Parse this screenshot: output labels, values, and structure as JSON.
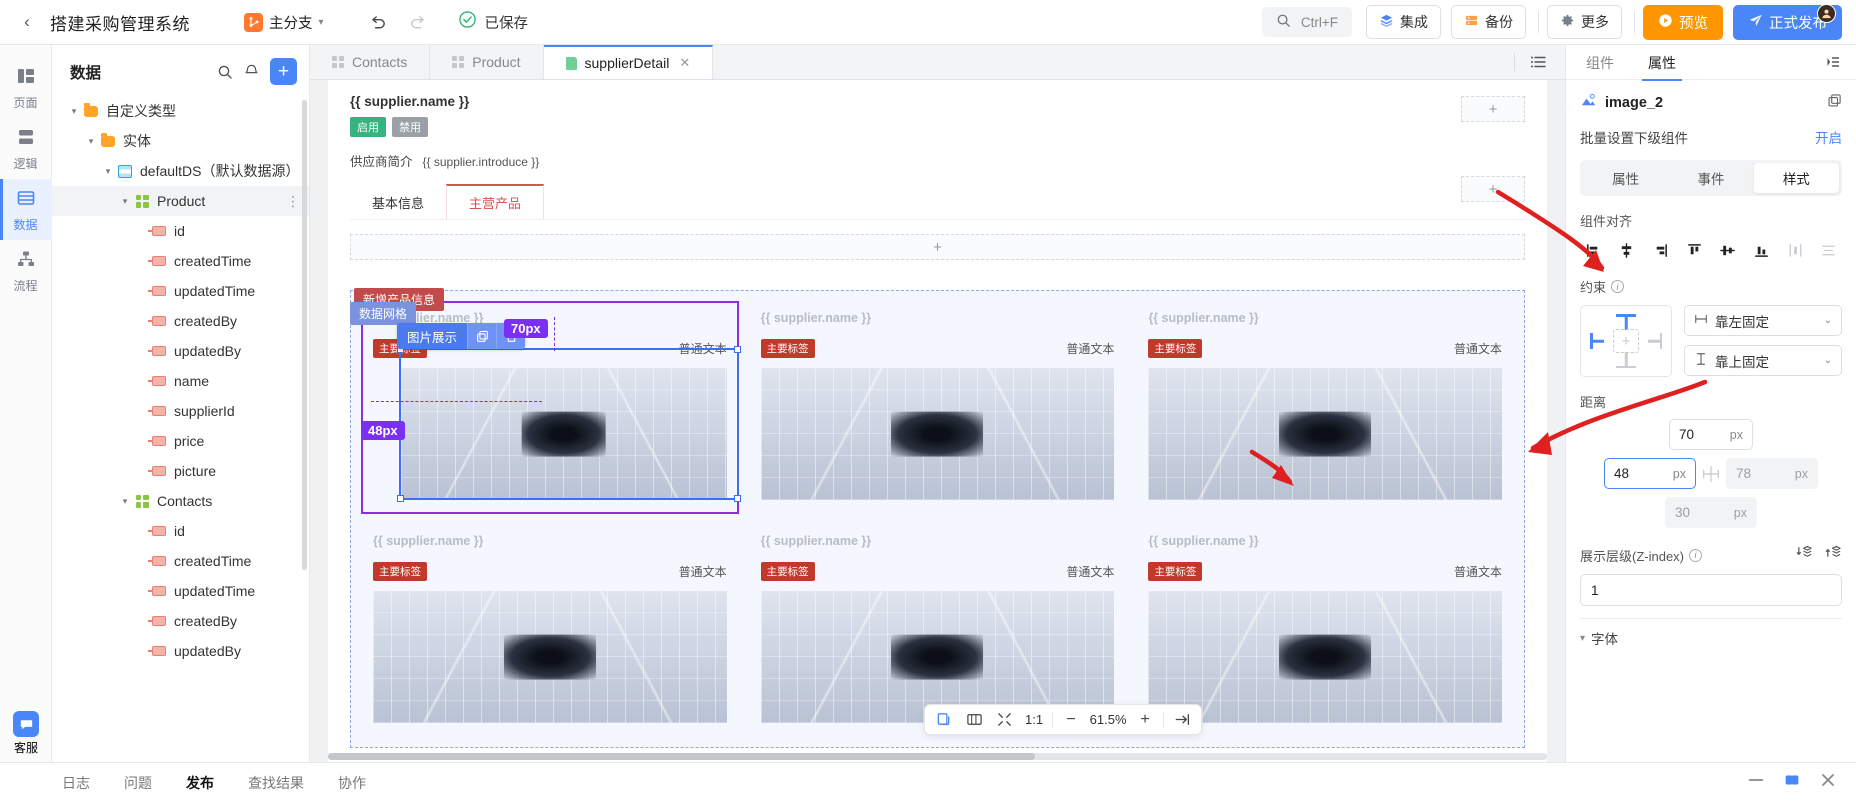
{
  "topbar": {
    "back_icon": "chevron-left-icon",
    "title": "搭建采购管理系统",
    "branch": {
      "label": "主分支",
      "icon": "branch-icon",
      "caret": "▾"
    },
    "undo_icon": "undo-icon",
    "redo_icon": "redo-icon",
    "saved": {
      "icon": "check-circle-icon",
      "text": "已保存"
    },
    "search": {
      "icon": "search-icon",
      "shortcut": "Ctrl+F"
    },
    "integration": {
      "icon": "layers-icon",
      "label": "集成"
    },
    "backup": {
      "icon": "database-icon",
      "label": "备份"
    },
    "more": {
      "icon": "gear-icon",
      "label": "更多"
    },
    "preview": {
      "icon": "play-icon",
      "label": "预览"
    },
    "publish": {
      "icon": "send-icon",
      "label": "正式发布"
    }
  },
  "rail": {
    "items": [
      {
        "label": "页面",
        "icon": "pages-icon",
        "active": false
      },
      {
        "label": "逻辑",
        "icon": "logic-icon",
        "active": false
      },
      {
        "label": "数据",
        "icon": "data-icon",
        "active": true
      },
      {
        "label": "流程",
        "icon": "flow-icon",
        "active": false
      }
    ],
    "support": {
      "label": "客服",
      "icon": "chat-icon"
    }
  },
  "tree": {
    "title": "数据",
    "search_icon": "search-icon",
    "bell_icon": "notify-icon",
    "add_label": "+",
    "nodes": [
      {
        "label": "自定义类型",
        "type": "folder",
        "depth": 0,
        "twist": "▾"
      },
      {
        "label": "实体",
        "type": "folder",
        "depth": 1,
        "twist": "▾"
      },
      {
        "label": "defaultDS（默认数据源）",
        "type": "ds",
        "depth": 2,
        "twist": "▾"
      },
      {
        "label": "Product",
        "type": "entity",
        "depth": 3,
        "twist": "▾",
        "selected": true,
        "dots": "⋮"
      },
      {
        "label": "id",
        "type": "field",
        "depth": 4
      },
      {
        "label": "createdTime",
        "type": "field",
        "depth": 4
      },
      {
        "label": "updatedTime",
        "type": "field",
        "depth": 4
      },
      {
        "label": "createdBy",
        "type": "field",
        "depth": 4
      },
      {
        "label": "updatedBy",
        "type": "field",
        "depth": 4
      },
      {
        "label": "name",
        "type": "field",
        "depth": 4
      },
      {
        "label": "supplierId",
        "type": "field",
        "depth": 4
      },
      {
        "label": "price",
        "type": "field",
        "depth": 4
      },
      {
        "label": "picture",
        "type": "field",
        "depth": 4
      },
      {
        "label": "Contacts",
        "type": "entity",
        "depth": 3,
        "twist": "▾"
      },
      {
        "label": "id",
        "type": "field",
        "depth": 4
      },
      {
        "label": "createdTime",
        "type": "field",
        "depth": 4
      },
      {
        "label": "updatedTime",
        "type": "field",
        "depth": 4
      },
      {
        "label": "createdBy",
        "type": "field",
        "depth": 4
      },
      {
        "label": "updatedBy",
        "type": "field",
        "depth": 4
      }
    ]
  },
  "canvas": {
    "tabs": [
      {
        "label": "Contacts",
        "icon": "entity-icon",
        "active": false,
        "closable": false
      },
      {
        "label": "Product",
        "icon": "entity-icon",
        "active": false,
        "closable": false
      },
      {
        "label": "supplierDetail",
        "icon": "page-icon",
        "active": true,
        "closable": true,
        "close": "✕"
      }
    ],
    "outline_icon": "outline-list-icon",
    "page": {
      "supplier_name": "{{ supplier.name }}",
      "badge_enabled": "启用",
      "badge_disabled": "禁用",
      "intro_label": "供应商简介",
      "intro_value": "{{ supplier.introduce }}",
      "inner_tabs": [
        {
          "label": "基本信息",
          "active": false
        },
        {
          "label": "主营产品",
          "active": true
        }
      ],
      "plus_slot": "+",
      "add_product_tag": "新增产品信息",
      "grid_tag": "数据网格",
      "component_label": "图片展示",
      "copy_icon": "copy-icon",
      "delete_icon": "trash-icon",
      "size_top_badge": "70px",
      "size_left_badge": "48px",
      "cells": [
        {
          "title": "{{ supplier.name }}",
          "tag": "主要标签",
          "text": "普通文本"
        },
        {
          "title": "{{ supplier.name }}",
          "tag": "主要标签",
          "text": "普通文本"
        },
        {
          "title": "{{ supplier.name }}",
          "tag": "主要标签",
          "text": "普通文本"
        },
        {
          "title": "{{ supplier.name }}",
          "tag": "主要标签",
          "text": "普通文本"
        },
        {
          "title": "{{ supplier.name }}",
          "tag": "主要标签",
          "text": "普通文本"
        },
        {
          "title": "{{ supplier.name }}",
          "tag": "主要标签",
          "text": "普通文本"
        }
      ]
    },
    "zoombar": {
      "frame_icon": "frame-icon",
      "fit_icon": "fit-screen-icon",
      "shrink_icon": "collapse-icon",
      "ratio": "1:1",
      "minus": "−",
      "percent": "61.5%",
      "plus": "+",
      "next_icon": "arrow-right-icon"
    }
  },
  "right_panel": {
    "tabs": [
      {
        "label": "组件",
        "active": false
      },
      {
        "label": "属性",
        "active": true
      }
    ],
    "collapse_icon": "collapse-panel-icon",
    "component": {
      "name": "image_2",
      "icon": "image-icon",
      "copy_icon": "copy-icon"
    },
    "bulk": {
      "label": "批量设置下级组件",
      "action": "开启"
    },
    "sub_tabs": [
      {
        "label": "属性",
        "active": false
      },
      {
        "label": "事件",
        "active": false
      },
      {
        "label": "样式",
        "active": true
      }
    ],
    "align": {
      "label": "组件对齐",
      "buttons": [
        "align-left-icon",
        "align-center-horizontal-icon",
        "align-right-icon",
        "align-top-icon",
        "align-middle-vertical-icon",
        "align-bottom-icon",
        "distribute-horizontal-icon",
        "distribute-vertical-icon"
      ]
    },
    "constraint": {
      "label": "约束",
      "info": "ⓘ",
      "horizontal": {
        "value": "靠左固定",
        "icon": "horizontal-constraint-icon",
        "caret": "⌄"
      },
      "vertical": {
        "value": "靠上固定",
        "icon": "vertical-constraint-icon",
        "caret": "⌄"
      }
    },
    "distance": {
      "label": "距离",
      "top": {
        "value": "70",
        "unit": "px"
      },
      "left": {
        "value": "48",
        "unit": "px",
        "focused": true
      },
      "right": {
        "value": "78",
        "unit": "px",
        "disabled": true
      },
      "bottom": {
        "value": "30",
        "unit": "px",
        "disabled": true
      },
      "link_icon": "link-constraint-icon"
    },
    "zindex": {
      "label": "展示层级(Z-index)",
      "info": "ⓘ",
      "value": "1",
      "send_back_icon": "send-to-back-icon",
      "bring_front_icon": "bring-to-front-icon"
    },
    "font_section": {
      "label": "字体",
      "twist": "▾"
    }
  },
  "bottombar": {
    "tabs": [
      {
        "label": "日志",
        "active": false
      },
      {
        "label": "问题",
        "active": false
      },
      {
        "label": "发布",
        "active": true
      },
      {
        "label": "查找结果",
        "active": false
      },
      {
        "label": "协作",
        "active": false
      }
    ],
    "icons": [
      "minimize-icon",
      "maximize-icon",
      "close-icon"
    ]
  },
  "colors": {
    "accent": "#4a86f7",
    "orange": "#ff9500",
    "green": "#36b37e",
    "red_tag": "#c0392b",
    "purple": "#7b2ff2",
    "annotation": "#e02020"
  }
}
